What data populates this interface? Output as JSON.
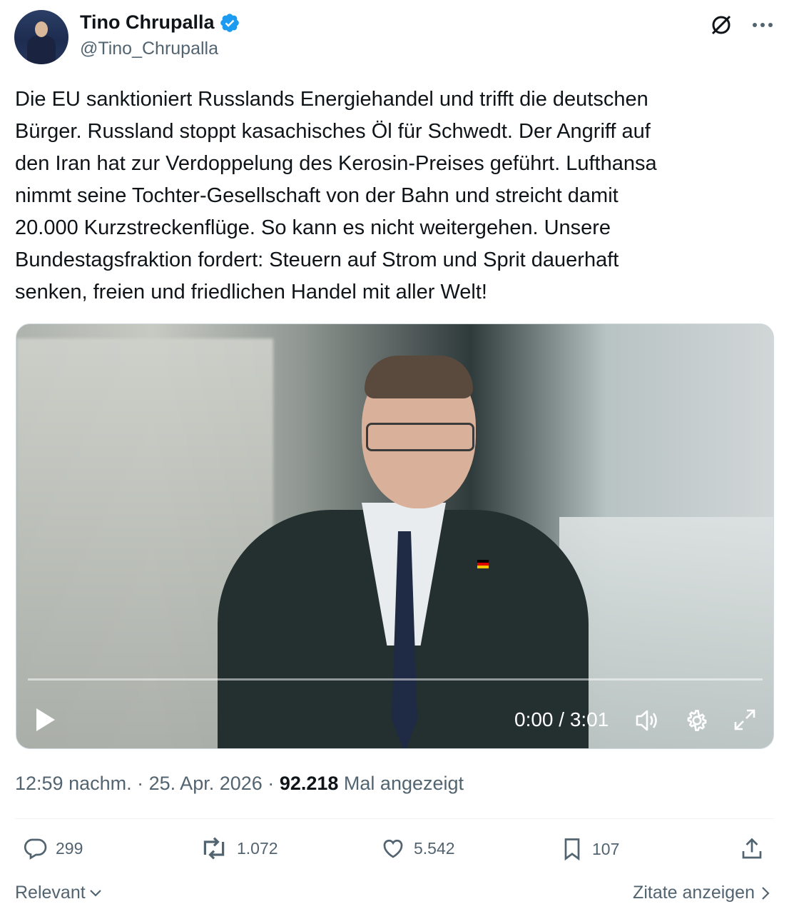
{
  "author": {
    "name": "Tino Chrupalla",
    "handle": "@Tino_Chrupalla"
  },
  "tweet": {
    "text": "Die EU sanktioniert Russlands Energiehandel und trifft die deutschen\nBürger. Russland stoppt kasachisches Öl für Schwedt. Der Angriff auf\nden Iran hat zur Verdoppelung des Kerosin-Preises geführt. Lufthansa\nnimmt seine Tochter-Gesellschaft von der Bahn und streicht damit\n20.000 Kurzstreckenflüge. So kann es nicht weitergehen. Unsere\nBundestagsfraktion fordert: Steuern auf Strom und Sprit dauerhaft\nsenken, freien und friedlichen Handel mit aller Welt!"
  },
  "video": {
    "timecode": "0:00 / 3:01",
    "progress": 0
  },
  "meta": {
    "time": "12:59 nachm.",
    "separator": "·",
    "date": "25. Apr. 2026",
    "views": "92.218",
    "views_label": "Mal angezeigt"
  },
  "actions": {
    "replies": "299",
    "reposts": "1.072",
    "likes": "5.542",
    "bookmarks": "107"
  },
  "footer": {
    "sort_label": "Relevant",
    "quotes_label": "Zitate anzeigen"
  },
  "colors": {
    "verified": "#1d9bf0",
    "muted": "#536471",
    "text": "#0f1419"
  },
  "icons": [
    "verified-badge-icon",
    "grok-icon",
    "more-icon",
    "play-icon",
    "volume-icon",
    "settings-icon",
    "fullscreen-icon",
    "reply-icon",
    "repost-icon",
    "like-icon",
    "bookmark-icon",
    "share-icon",
    "chevron-down-icon",
    "chevron-right-icon"
  ]
}
